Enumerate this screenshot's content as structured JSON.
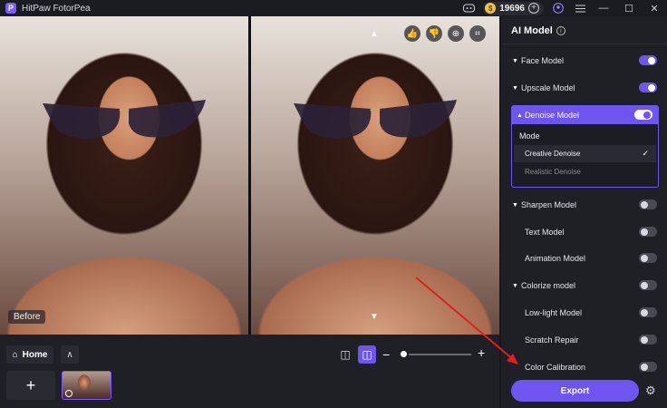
{
  "app": {
    "logo_letter": "P",
    "title": "HitPaw FotorPea",
    "coins": "19696"
  },
  "titlebar_icons": [
    "discord-icon",
    "coin-icon",
    "add-icon",
    "account-icon",
    "menu-icon"
  ],
  "window_controls": {
    "minimize": "—",
    "maximize": "☐",
    "close": "✕"
  },
  "viewer": {
    "before_label": "Before",
    "tools": {
      "like": "👍",
      "dislike": "👎",
      "zoom": "⊕",
      "crop": "⌗"
    },
    "arrow_up": "▲",
    "arrow_down": "▼"
  },
  "bottom": {
    "home_label": "Home",
    "home_icon": "⌂",
    "up_icon": "∧",
    "add_icon": "+",
    "split_icon": "◫",
    "compare_icon": "◫",
    "zoom_minus": "−",
    "zoom_plus": "+",
    "zoom_level": 0.05
  },
  "panel": {
    "title": "AI Model",
    "info_icon": "i",
    "models": [
      {
        "label": "Face Model",
        "caret": "▼",
        "on": true
      },
      {
        "label": "Upscale Model",
        "caret": "▼",
        "on": true
      },
      {
        "label": "Sharpen Model",
        "caret": "▼",
        "on": false
      },
      {
        "label": "Text Model",
        "caret": "",
        "on": false
      },
      {
        "label": "Animation Model",
        "caret": "",
        "on": false
      },
      {
        "label": "Colorize model",
        "caret": "▼",
        "on": false
      },
      {
        "label": "Low-light Model",
        "caret": "",
        "on": false
      },
      {
        "label": "Scratch Repair",
        "caret": "",
        "on": false
      },
      {
        "label": "Color Calibration",
        "caret": "",
        "on": false
      }
    ],
    "denoise": {
      "label": "Denoise Model",
      "caret": "▲",
      "on": true,
      "mode_label": "Mode",
      "options": [
        "Creative Denoise",
        "Realistic Denoise"
      ],
      "selected": "Creative Denoise",
      "check": "✓"
    },
    "export_label": "Export",
    "settings_icon": "⚙"
  },
  "colors": {
    "accent": "#6e55f0",
    "panel_bg": "#1f1f26",
    "annotation_arrow": "#e02020"
  }
}
